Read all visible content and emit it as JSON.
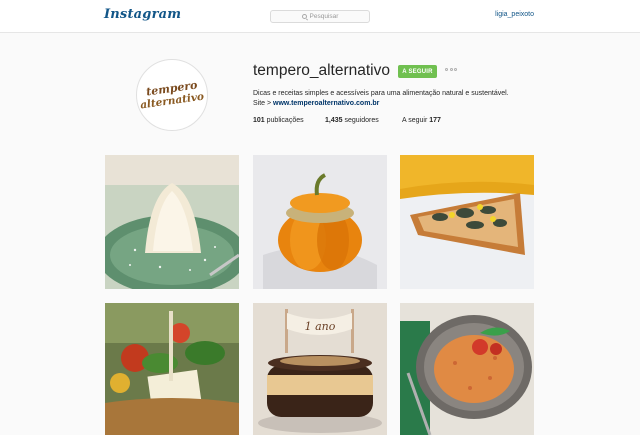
{
  "header": {
    "logo": "Instagram",
    "search_placeholder": "Pesquisar",
    "current_user": "ligia_peixoto"
  },
  "profile": {
    "username": "tempero_alternativo",
    "follow_label": "A SEGUIR",
    "avatar_lines": [
      "tempero",
      "alternativo"
    ],
    "bio_line1": "Dicas e receitas simples e acessíveis para uma alimentação natural e sustentável.",
    "bio_site_prefix": "Site > ",
    "bio_site": "www.temperoalternativo.com.br",
    "stats": {
      "posts_count": "101",
      "posts_label": "publicações",
      "followers_count": "1,435",
      "followers_label": "seguidores",
      "following_label": "A seguir",
      "following_count": "177"
    }
  },
  "posts": [
    {
      "subject": "coconut cake on green plate"
    },
    {
      "subject": "stuffed mini pumpkin"
    },
    {
      "subject": "bruschetta with grilled vegetables"
    },
    {
      "subject": "vegetable basket at market"
    },
    {
      "subject": "layered chocolate cake with 1 ano banner",
      "banner_text": "1 ano"
    },
    {
      "subject": "tomato rice dish"
    }
  ],
  "colors": {
    "accent_link": "#125688",
    "follow_button": "#70c050",
    "background": "#fafafa"
  }
}
